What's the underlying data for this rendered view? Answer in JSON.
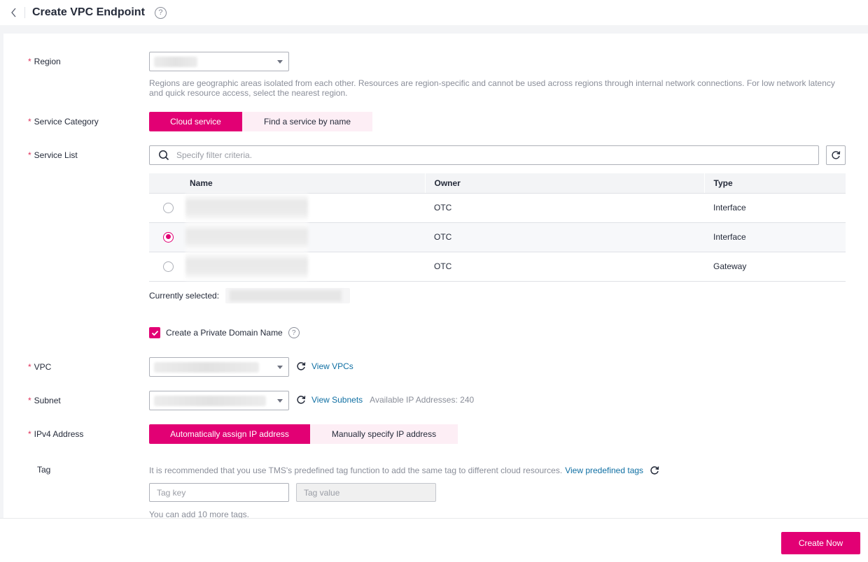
{
  "header": {
    "title": "Create VPC Endpoint",
    "back_icon": "chevron-left-icon",
    "help_icon": "question-circle-icon",
    "help_glyph": "?"
  },
  "form": {
    "region": {
      "label": "Region",
      "required_mark": "*",
      "value": "",
      "hint_line1": "Regions are geographic areas isolated from each other. Resources are region-specific and cannot be used across regions through internal network connections. For low network latency",
      "hint_line2": "and quick resource access, select the nearest region."
    },
    "service_category": {
      "label": "Service Category",
      "required_mark": "*",
      "options": [
        "Cloud service",
        "Find a service by name"
      ],
      "selected": "Cloud service"
    },
    "service_list": {
      "label": "Service List",
      "required_mark": "*",
      "search_placeholder": "Specify filter criteria.",
      "search_icon": "search-icon",
      "refresh_icon": "refresh-icon",
      "columns": [
        "Name",
        "Owner",
        "Type"
      ],
      "rows": [
        {
          "name": "",
          "owner": "OTC",
          "type": "Interface",
          "selected": false
        },
        {
          "name": "",
          "owner": "OTC",
          "type": "Interface",
          "selected": true
        },
        {
          "name": "",
          "owner": "OTC",
          "type": "Gateway",
          "selected": false
        }
      ],
      "currently_selected_label": "Currently selected:",
      "currently_selected_value": ""
    },
    "private_domain": {
      "label": "Create a Private Domain Name",
      "checked": true,
      "help_glyph": "?"
    },
    "vpc": {
      "label": "VPC",
      "required_mark": "*",
      "value": "",
      "link": "View VPCs"
    },
    "subnet": {
      "label": "Subnet",
      "required_mark": "*",
      "value": "",
      "link": "View Subnets",
      "available_ips": "Available IP Addresses: 240"
    },
    "ipv4": {
      "label": "IPv4 Address",
      "required_mark": "*",
      "options": [
        "Automatically assign IP address",
        "Manually specify IP address"
      ],
      "selected": "Automatically assign IP address"
    },
    "tag": {
      "label": "Tag",
      "hint": "It is recommended that you use TMS's predefined tag function to add the same tag to different cloud resources.",
      "link": "View predefined tags",
      "key_placeholder": "Tag key",
      "value_placeholder": "Tag value",
      "remaining": "You can add 10 more tags."
    }
  },
  "footer": {
    "create_label": "Create Now"
  },
  "colors": {
    "accent": "#e20074",
    "accent_light": "#fdeef5",
    "link": "#0f6fa3",
    "required": "#e0325b"
  }
}
